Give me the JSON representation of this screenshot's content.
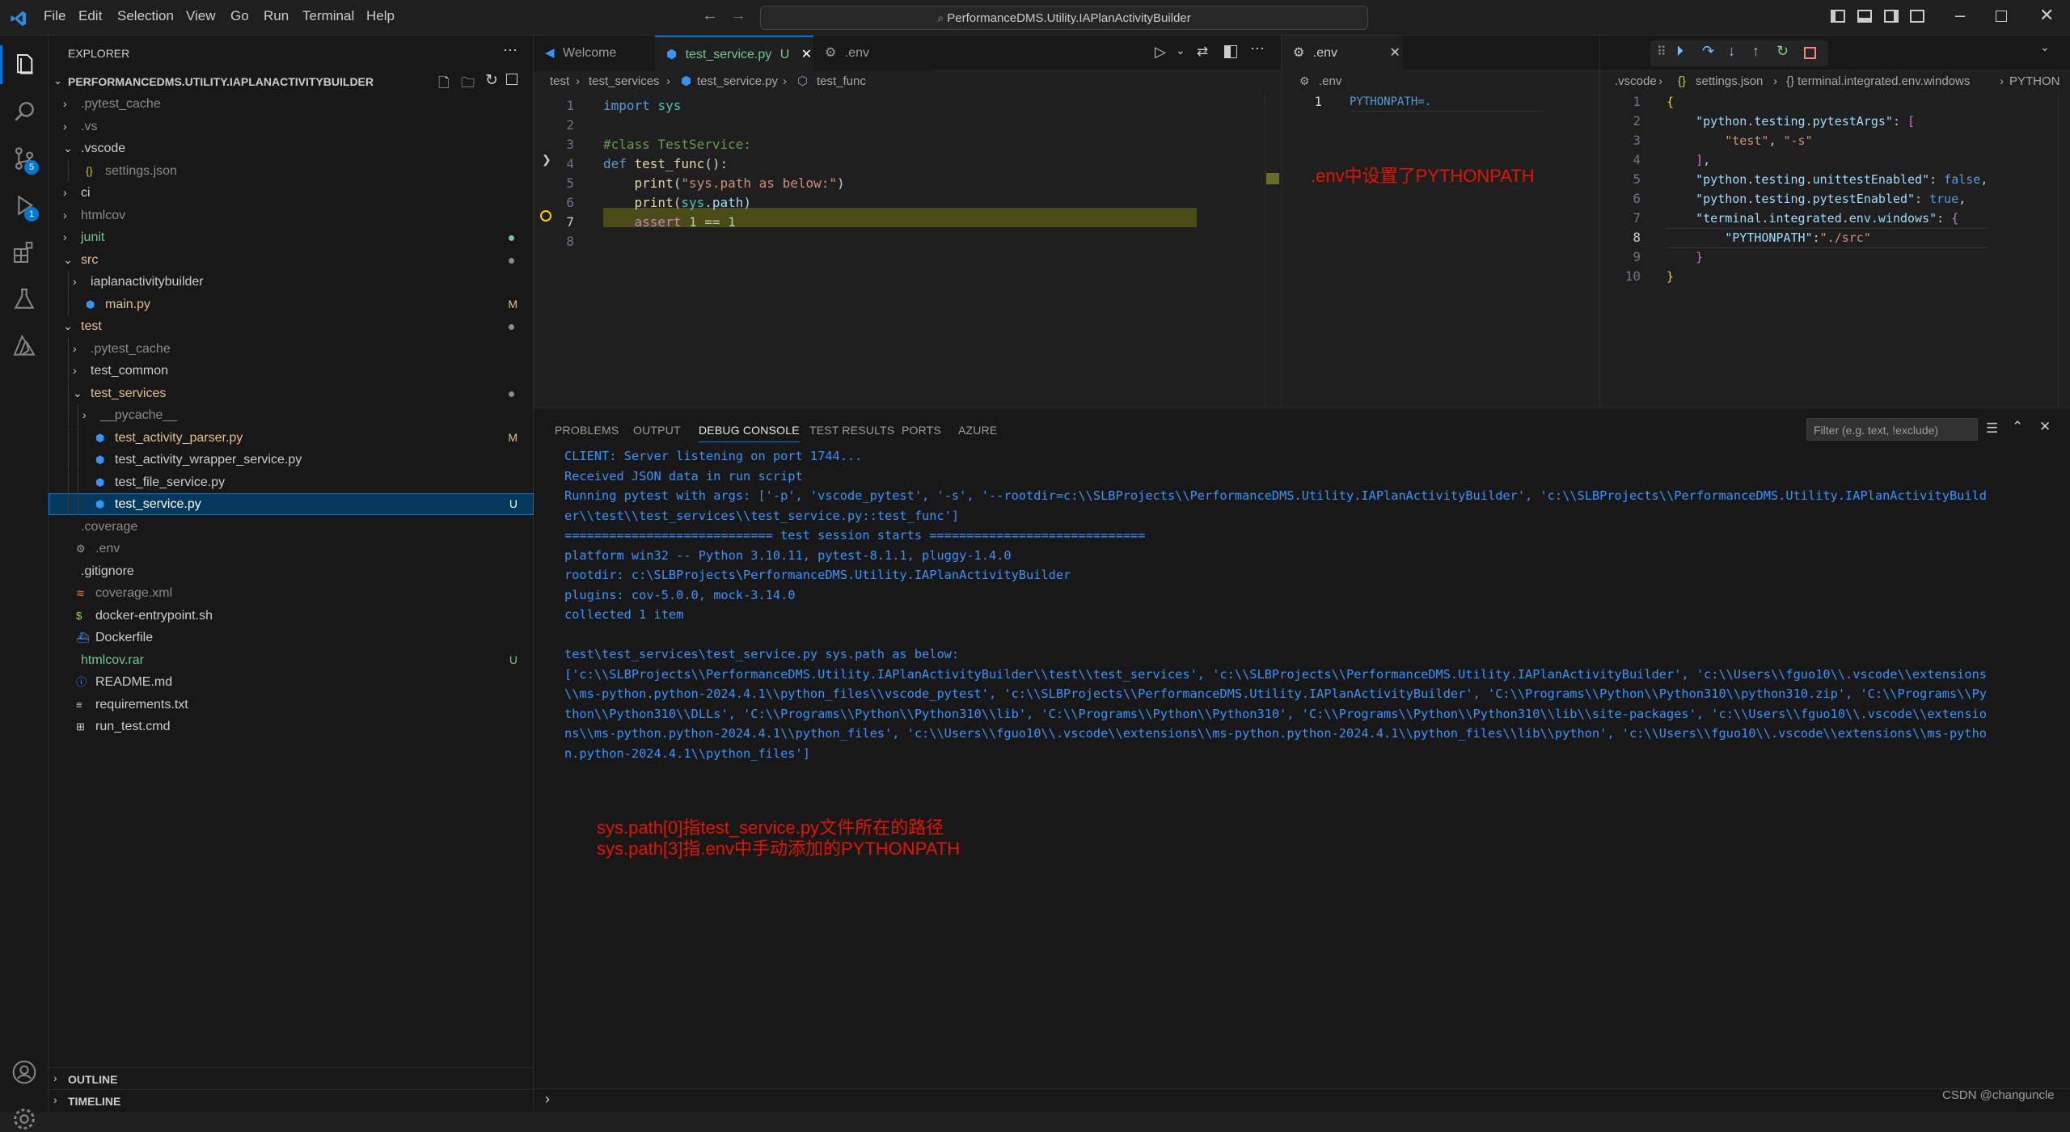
{
  "menu": [
    "File",
    "Edit",
    "Selection",
    "View",
    "Go",
    "Run",
    "Terminal",
    "Help"
  ],
  "command_center": "PerformanceDMS.Utility.IAPlanActivityBuilder",
  "explorer": {
    "title": "EXPLORER",
    "root": "PERFORMANCEDMS.UTILITY.IAPLANACTIVITYBUILDER",
    "items": [
      {
        "label": ".pytest_cache",
        "indent": 0,
        "chev": "›",
        "color": "#8b8b8b",
        "icon": ""
      },
      {
        "label": ".vs",
        "indent": 0,
        "chev": "›",
        "color": "#8b8b8b",
        "icon": ""
      },
      {
        "label": ".vscode",
        "indent": 0,
        "chev": "⌄",
        "color": "#cccccc",
        "icon": ""
      },
      {
        "label": "settings.json",
        "indent": 1,
        "chev": "",
        "color": "#8b8b8b",
        "icon": "{}"
      },
      {
        "label": "ci",
        "indent": 0,
        "chev": "›",
        "color": "#cccccc",
        "icon": ""
      },
      {
        "label": "htmlcov",
        "indent": 0,
        "chev": "›",
        "color": "#8b8b8b",
        "icon": ""
      },
      {
        "label": "junit",
        "indent": 0,
        "chev": "›",
        "color": "#73c991",
        "icon": "",
        "dot": "#73c991"
      },
      {
        "label": "src",
        "indent": 0,
        "chev": "⌄",
        "color": "#e2c08d",
        "icon": "",
        "dot": "#8b8b8b"
      },
      {
        "label": "iaplanactivitybuilder",
        "indent": 1,
        "chev": "›",
        "color": "#cccccc",
        "icon": ""
      },
      {
        "label": "main.py",
        "indent": 1,
        "chev": "",
        "color": "#e2c08d",
        "icon": "py",
        "badge": "M",
        "badgeColor": "#e2c08d"
      },
      {
        "label": "test",
        "indent": 0,
        "chev": "⌄",
        "color": "#e2c08d",
        "icon": "",
        "dot": "#8b8b8b"
      },
      {
        "label": ".pytest_cache",
        "indent": 1,
        "chev": "›",
        "color": "#8b8b8b",
        "icon": ""
      },
      {
        "label": "test_common",
        "indent": 1,
        "chev": "›",
        "color": "#cccccc",
        "icon": ""
      },
      {
        "label": "test_services",
        "indent": 1,
        "chev": "⌄",
        "color": "#e2c08d",
        "icon": "",
        "dot": "#8b8b8b"
      },
      {
        "label": "__pycache__",
        "indent": 2,
        "chev": "›",
        "color": "#8b8b8b",
        "icon": ""
      },
      {
        "label": "test_activity_parser.py",
        "indent": 2,
        "chev": "",
        "color": "#e2c08d",
        "icon": "py",
        "badge": "M",
        "badgeColor": "#e2c08d"
      },
      {
        "label": "test_activity_wrapper_service.py",
        "indent": 2,
        "chev": "",
        "color": "#cccccc",
        "icon": "py"
      },
      {
        "label": "test_file_service.py",
        "indent": 2,
        "chev": "",
        "color": "#cccccc",
        "icon": "py"
      },
      {
        "label": "test_service.py",
        "indent": 2,
        "chev": "",
        "color": "#ffffff",
        "icon": "py",
        "badge": "U",
        "badgeColor": "#ffffff",
        "selected": true
      },
      {
        "label": ".coverage",
        "indent": 0,
        "chev": "",
        "color": "#8b8b8b",
        "icon": ""
      },
      {
        "label": ".env",
        "indent": 0,
        "chev": "",
        "color": "#8b8b8b",
        "icon": "gear"
      },
      {
        "label": ".gitignore",
        "indent": 0,
        "chev": "",
        "color": "#cccccc",
        "icon": ""
      },
      {
        "label": "coverage.xml",
        "indent": 0,
        "chev": "",
        "color": "#8b8b8b",
        "icon": "rss"
      },
      {
        "label": "docker-entrypoint.sh",
        "indent": 0,
        "chev": "",
        "color": "#cccccc",
        "icon": "$"
      },
      {
        "label": "Dockerfile",
        "indent": 0,
        "chev": "",
        "color": "#cccccc",
        "icon": "whale"
      },
      {
        "label": "htmlcov.rar",
        "indent": 0,
        "chev": "",
        "color": "#73c991",
        "icon": "",
        "badge": "U",
        "badgeColor": "#73c991"
      },
      {
        "label": "README.md",
        "indent": 0,
        "chev": "",
        "color": "#cccccc",
        "icon": "info"
      },
      {
        "label": "requirements.txt",
        "indent": 0,
        "chev": "",
        "color": "#cccccc",
        "icon": "lines"
      },
      {
        "label": "run_test.cmd",
        "indent": 0,
        "chev": "",
        "color": "#cccccc",
        "icon": "win"
      }
    ],
    "outline": "OUTLINE",
    "timeline": "TIMELINE"
  },
  "editor1": {
    "tabs": [
      {
        "label": "Welcome",
        "active": false
      },
      {
        "label": "test_service.py",
        "suffix": "U",
        "active": true
      },
      {
        "label": ".env",
        "active": false
      }
    ],
    "breadcrumb": [
      "test",
      "test_services",
      "test_service.py",
      "test_func"
    ],
    "lines": [
      {
        "n": "1",
        "segs": [
          [
            "import ",
            "#569cd6"
          ],
          [
            "sys",
            "#4ec9b0"
          ]
        ]
      },
      {
        "n": "2",
        "segs": []
      },
      {
        "n": "3",
        "segs": [
          [
            "#class TestService:",
            "#6a9955"
          ]
        ]
      },
      {
        "n": "4",
        "segs": [
          [
            "def ",
            "#569cd6"
          ],
          [
            "test_func",
            "#dcdcaa"
          ],
          [
            "():",
            "#cccccc"
          ]
        ]
      },
      {
        "n": "5",
        "segs": [
          [
            "    print",
            "#dcdcaa"
          ],
          [
            "(",
            "#cccccc"
          ],
          [
            "\"sys.path as below:\"",
            "#ce9178"
          ],
          [
            ")",
            "#cccccc"
          ]
        ]
      },
      {
        "n": "6",
        "segs": [
          [
            "    print",
            "#dcdcaa"
          ],
          [
            "(",
            "#cccccc"
          ],
          [
            "sys",
            "#4ec9b0"
          ],
          [
            ".path)",
            "#9cdcfe"
          ]
        ]
      },
      {
        "n": "7",
        "segs": [
          [
            "    assert ",
            "#c586c0"
          ],
          [
            "1 == 1",
            "#b5cea8"
          ]
        ],
        "highlight": true
      },
      {
        "n": "8",
        "segs": []
      }
    ]
  },
  "editor2": {
    "tab": ".env",
    "breadcrumb": ".env",
    "lines": [
      {
        "n": "1",
        "text": "PYTHONPATH=."
      }
    ],
    "annotation": ".env中设置了PYTHONPATH"
  },
  "editor3": {
    "breadcrumb": [
      ".vscode",
      "settings.json",
      "{} terminal.integrated.env.windows",
      "PYTHON"
    ],
    "lines": [
      {
        "n": "1",
        "segs": [
          [
            "{",
            "#ffd700"
          ]
        ]
      },
      {
        "n": "2",
        "segs": [
          [
            "    \"python.testing.pytestArgs\"",
            "#9cdcfe"
          ],
          [
            ": ",
            "#cccccc"
          ],
          [
            "[",
            "#da70d6"
          ]
        ]
      },
      {
        "n": "3",
        "segs": [
          [
            "        \"test\"",
            "#ce9178"
          ],
          [
            ", ",
            "#cccccc"
          ],
          [
            "\"-s\"",
            "#ce9178"
          ]
        ]
      },
      {
        "n": "4",
        "segs": [
          [
            "    ]",
            "#da70d6"
          ],
          [
            ",",
            "#cccccc"
          ]
        ]
      },
      {
        "n": "5",
        "segs": [
          [
            "    \"python.testing.unittestEnabled\"",
            "#9cdcfe"
          ],
          [
            ": ",
            "#cccccc"
          ],
          [
            "false",
            "#569cd6"
          ],
          [
            ",",
            "#cccccc"
          ]
        ]
      },
      {
        "n": "6",
        "segs": [
          [
            "    \"python.testing.pytestEnabled\"",
            "#9cdcfe"
          ],
          [
            ": ",
            "#cccccc"
          ],
          [
            "true",
            "#569cd6"
          ],
          [
            ",",
            "#cccccc"
          ]
        ]
      },
      {
        "n": "7",
        "segs": [
          [
            "    \"terminal.integrated.env.windows\"",
            "#9cdcfe"
          ],
          [
            ": ",
            "#cccccc"
          ],
          [
            "{",
            "#da70d6"
          ]
        ]
      },
      {
        "n": "8",
        "segs": [
          [
            "        \"PYTHONPATH\"",
            "#9cdcfe"
          ],
          [
            ":",
            "#cccccc"
          ],
          [
            "\"./src\"",
            "#ce9178"
          ]
        ]
      },
      {
        "n": "9",
        "segs": [
          [
            "    }",
            "#da70d6"
          ]
        ]
      },
      {
        "n": "10",
        "segs": [
          [
            "}",
            "#ffd700"
          ]
        ]
      }
    ]
  },
  "panel": {
    "tabs": [
      "PROBLEMS",
      "OUTPUT",
      "DEBUG CONSOLE",
      "TEST RESULTS",
      "PORTS",
      "AZURE"
    ],
    "active_tab": "DEBUG CONSOLE",
    "filter_placeholder": "Filter (e.g. text, !exclude)",
    "output": [
      "CLIENT: Server listening on port 1744...",
      "Received JSON data in run script",
      "Running pytest with args: ['-p', 'vscode_pytest', '-s', '--rootdir=c:\\\\SLBProjects\\\\PerformanceDMS.Utility.IAPlanActivityBuilder', 'c:\\\\SLBProjects\\\\PerformanceDMS.Utility.IAPlanActivityBuild",
      "er\\\\test\\\\test_services\\\\test_service.py::test_func']",
      "============================ test session starts =============================",
      "platform win32 -- Python 3.10.11, pytest-8.1.1, pluggy-1.4.0",
      "rootdir: c:\\SLBProjects\\PerformanceDMS.Utility.IAPlanActivityBuilder",
      "plugins: cov-5.0.0, mock-3.14.0",
      "collected 1 item",
      "",
      "test\\test_services\\test_service.py sys.path as below:",
      "['c:\\\\SLBProjects\\\\PerformanceDMS.Utility.IAPlanActivityBuilder\\\\test\\\\test_services', 'c:\\\\SLBProjects\\\\PerformanceDMS.Utility.IAPlanActivityBuilder', 'c:\\\\Users\\\\fguo10\\\\.vscode\\\\extensions",
      "\\\\ms-python.python-2024.4.1\\\\python_files\\\\vscode_pytest', 'c:\\\\SLBProjects\\\\PerformanceDMS.Utility.IAPlanActivityBuilder', 'C:\\\\Programs\\\\Python\\\\Python310\\\\python310.zip', 'C:\\\\Programs\\\\Py",
      "thon\\\\Python310\\\\DLLs', 'C:\\\\Programs\\\\Python\\\\Python310\\\\lib', 'C:\\\\Programs\\\\Python\\\\Python310', 'C:\\\\Programs\\\\Python\\\\Python310\\\\lib\\\\site-packages', 'c:\\\\Users\\\\fguo10\\\\.vscode\\\\extensio",
      "ns\\\\ms-python.python-2024.4.1\\\\python_files', 'c:\\\\Users\\\\fguo10\\\\.vscode\\\\extensions\\\\ms-python.python-2024.4.1\\\\python_files\\\\lib\\\\python', 'c:\\\\Users\\\\fguo10\\\\.vscode\\\\extensions\\\\ms-pytho",
      "n.python-2024.4.1\\\\python_files']"
    ],
    "annotation_line1": "sys.path[0]指test_service.py文件所在的路径",
    "annotation_line2": "sys.path[3]指.env中手动添加的PYTHONPATH",
    "prompt": "›"
  },
  "badges": {
    "scm": "5",
    "debug": "1"
  },
  "watermark": "CSDN @changuncle"
}
